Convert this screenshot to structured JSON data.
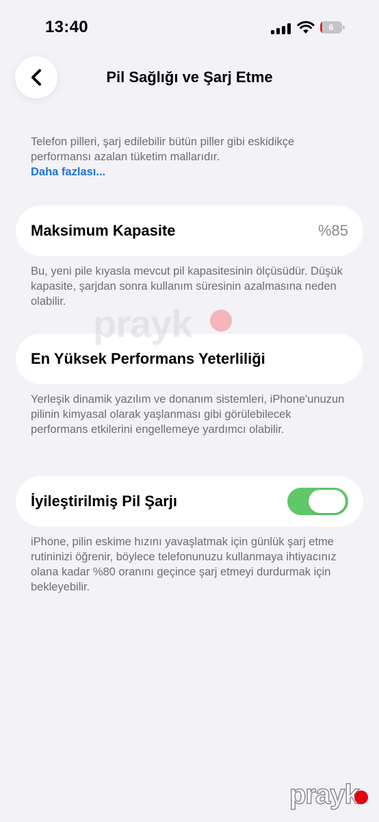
{
  "status_bar": {
    "time": "13:40",
    "battery_level": "6",
    "battery_percent": 6,
    "battery_color": "#e0262c"
  },
  "nav": {
    "title": "Pil Sağlığı ve Şarj Etme",
    "back_icon": "chevron-left-icon"
  },
  "intro": {
    "text": "Telefon pilleri, şarj edilebilir bütün piller gibi eskidikçe performansı azalan tüketim mallarıdır.",
    "link": "Daha fazlası..."
  },
  "max_capacity": {
    "label": "Maksimum Kapasite",
    "value": "%85",
    "footnote": "Bu, yeni pile kıyasla mevcut pil kapasitesinin ölçüsüdür. Düşük kapasite, şarjdan sonra kullanım süresinin azalmasına neden olabilir."
  },
  "peak_performance": {
    "label": "En Yüksek Performans Yeterliliği",
    "footnote": "Yerleşik dinamik yazılım ve donanım sistemleri, iPhone'unuzun pilinin kimyasal olarak yaşlanması gibi görülebilecek performans etkilerini engellemeye yardımcı olabilir."
  },
  "optimized_charging": {
    "label": "İyileştirilmiş Pil Şarjı",
    "enabled": true,
    "footnote": "iPhone, pilin eskime hızını yavaşlatmak için günlük şarj etme rutininizi öğrenir, böylece telefonunuzu kullanmaya ihtiyacınız olana kadar %80 oranını geçince şarj etmeyi durdurmak için bekleyebilir.",
    "toggle_color": "#5fc868"
  },
  "watermark": {
    "text": "prayk",
    "dot_color": "#e3000f"
  }
}
